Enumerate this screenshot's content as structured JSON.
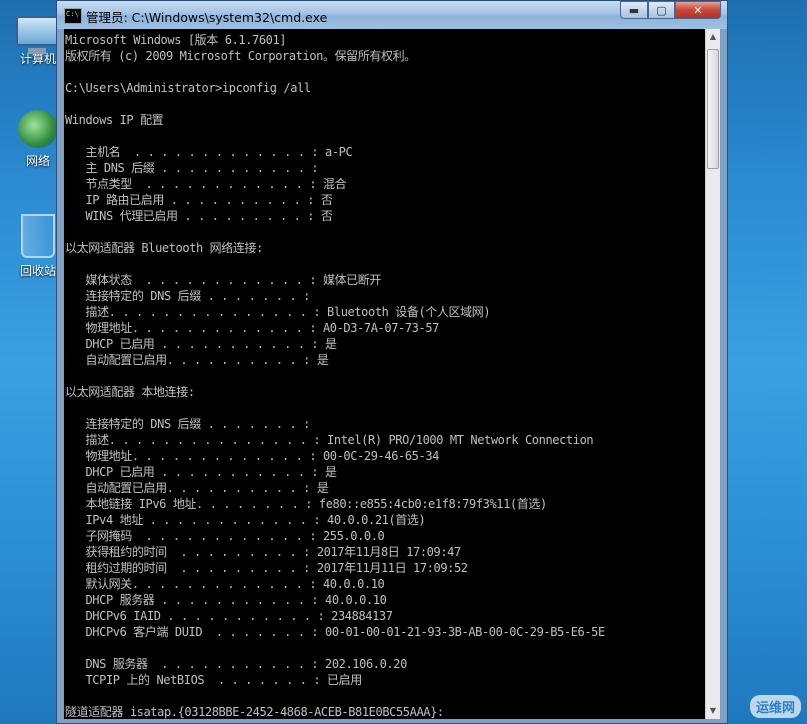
{
  "desktop": {
    "icons": [
      {
        "label": "计算机",
        "icon": "computer-icon"
      },
      {
        "label": "网络",
        "icon": "network-icon"
      },
      {
        "label": "回收站",
        "icon": "recycle-bin-icon"
      }
    ]
  },
  "window": {
    "title": "管理员: C:\\Windows\\system32\\cmd.exe",
    "controls": {
      "minimize": "▬",
      "maximize": "▢",
      "close": "✕"
    },
    "console_lines": [
      "Microsoft Windows [版本 6.1.7601]",
      "版权所有 (c) 2009 Microsoft Corporation。保留所有权利。",
      "",
      "C:\\Users\\Administrator>ipconfig /all",
      "",
      "Windows IP 配置",
      "",
      "   主机名  . . . . . . . . . . . . . : a-PC",
      "   主 DNS 后缀 . . . . . . . . . . . :",
      "   节点类型  . . . . . . . . . . . . : 混合",
      "   IP 路由已启用 . . . . . . . . . . : 否",
      "   WINS 代理已启用 . . . . . . . . . : 否",
      "",
      "以太网适配器 Bluetooth 网络连接:",
      "",
      "   媒体状态  . . . . . . . . . . . . : 媒体已断开",
      "   连接特定的 DNS 后缀 . . . . . . . :",
      "   描述. . . . . . . . . . . . . . . : Bluetooth 设备(个人区域网)",
      "   物理地址. . . . . . . . . . . . . : A0-D3-7A-07-73-57",
      "   DHCP 已启用 . . . . . . . . . . . : 是",
      "   自动配置已启用. . . . . . . . . . : 是",
      "",
      "以太网适配器 本地连接:",
      "",
      "   连接特定的 DNS 后缀 . . . . . . . :",
      "   描述. . . . . . . . . . . . . . . : Intel(R) PRO/1000 MT Network Connection",
      "   物理地址. . . . . . . . . . . . . : 00-0C-29-46-65-34",
      "   DHCP 已启用 . . . . . . . . . . . : 是",
      "   自动配置已启用. . . . . . . . . . : 是",
      "   本地链接 IPv6 地址. . . . . . . . : fe80::e855:4cb0:e1f8:79f3%11(首选)",
      "   IPv4 地址 . . . . . . . . . . . . : 40.0.0.21(首选)",
      "   子网掩码  . . . . . . . . . . . . : 255.0.0.0",
      "   获得租约的时间  . . . . . . . . . : 2017年11月8日 17:09:47",
      "   租约过期的时间  . . . . . . . . . : 2017年11月11日 17:09:52",
      "   默认网关. . . . . . . . . . . . . : 40.0.0.10",
      "   DHCP 服务器 . . . . . . . . . . . : 40.0.0.10",
      "   DHCPv6 IAID . . . . . . . . . . . : 234884137",
      "   DHCPv6 客户端 DUID  . . . . . . . : 00-01-00-01-21-93-3B-AB-00-0C-29-B5-E6-5E",
      "",
      "   DNS 服务器  . . . . . . . . . . . : 202.106.0.20",
      "   TCPIP 上的 NetBIOS  . . . . . . . : 已启用",
      "",
      "隧道适配器 isatap.{03128BBE-2452-4868-ACEB-B81E0BC55AAA}:"
    ]
  },
  "watermark": "运维网"
}
